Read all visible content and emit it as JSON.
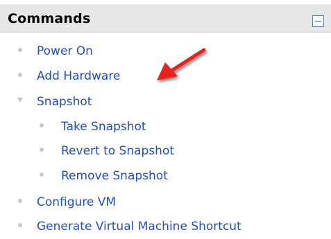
{
  "panel": {
    "title": "Commands",
    "collapse_icon": "minus-box-icon"
  },
  "commands": [
    {
      "label": "Power On",
      "level": 0,
      "marker": "bullet"
    },
    {
      "label": "Add Hardware",
      "level": 0,
      "marker": "bullet"
    },
    {
      "label": "Snapshot",
      "level": 0,
      "marker": "expander"
    },
    {
      "label": "Take Snapshot",
      "level": 1,
      "marker": "bullet"
    },
    {
      "label": "Revert to Snapshot",
      "level": 1,
      "marker": "bullet"
    },
    {
      "label": "Remove Snapshot",
      "level": 1,
      "marker": "bullet"
    },
    {
      "label": "Configure VM",
      "level": 0,
      "marker": "bullet"
    },
    {
      "label": "Generate Virtual Machine Shortcut",
      "level": 0,
      "marker": "bullet"
    }
  ],
  "annotation": {
    "icon": "red-arrow-icon",
    "color": "#e8201c"
  },
  "colors": {
    "header_bg": "#e7e7e7",
    "link": "#1f4fc4",
    "bullet": "#c8c8c8"
  }
}
